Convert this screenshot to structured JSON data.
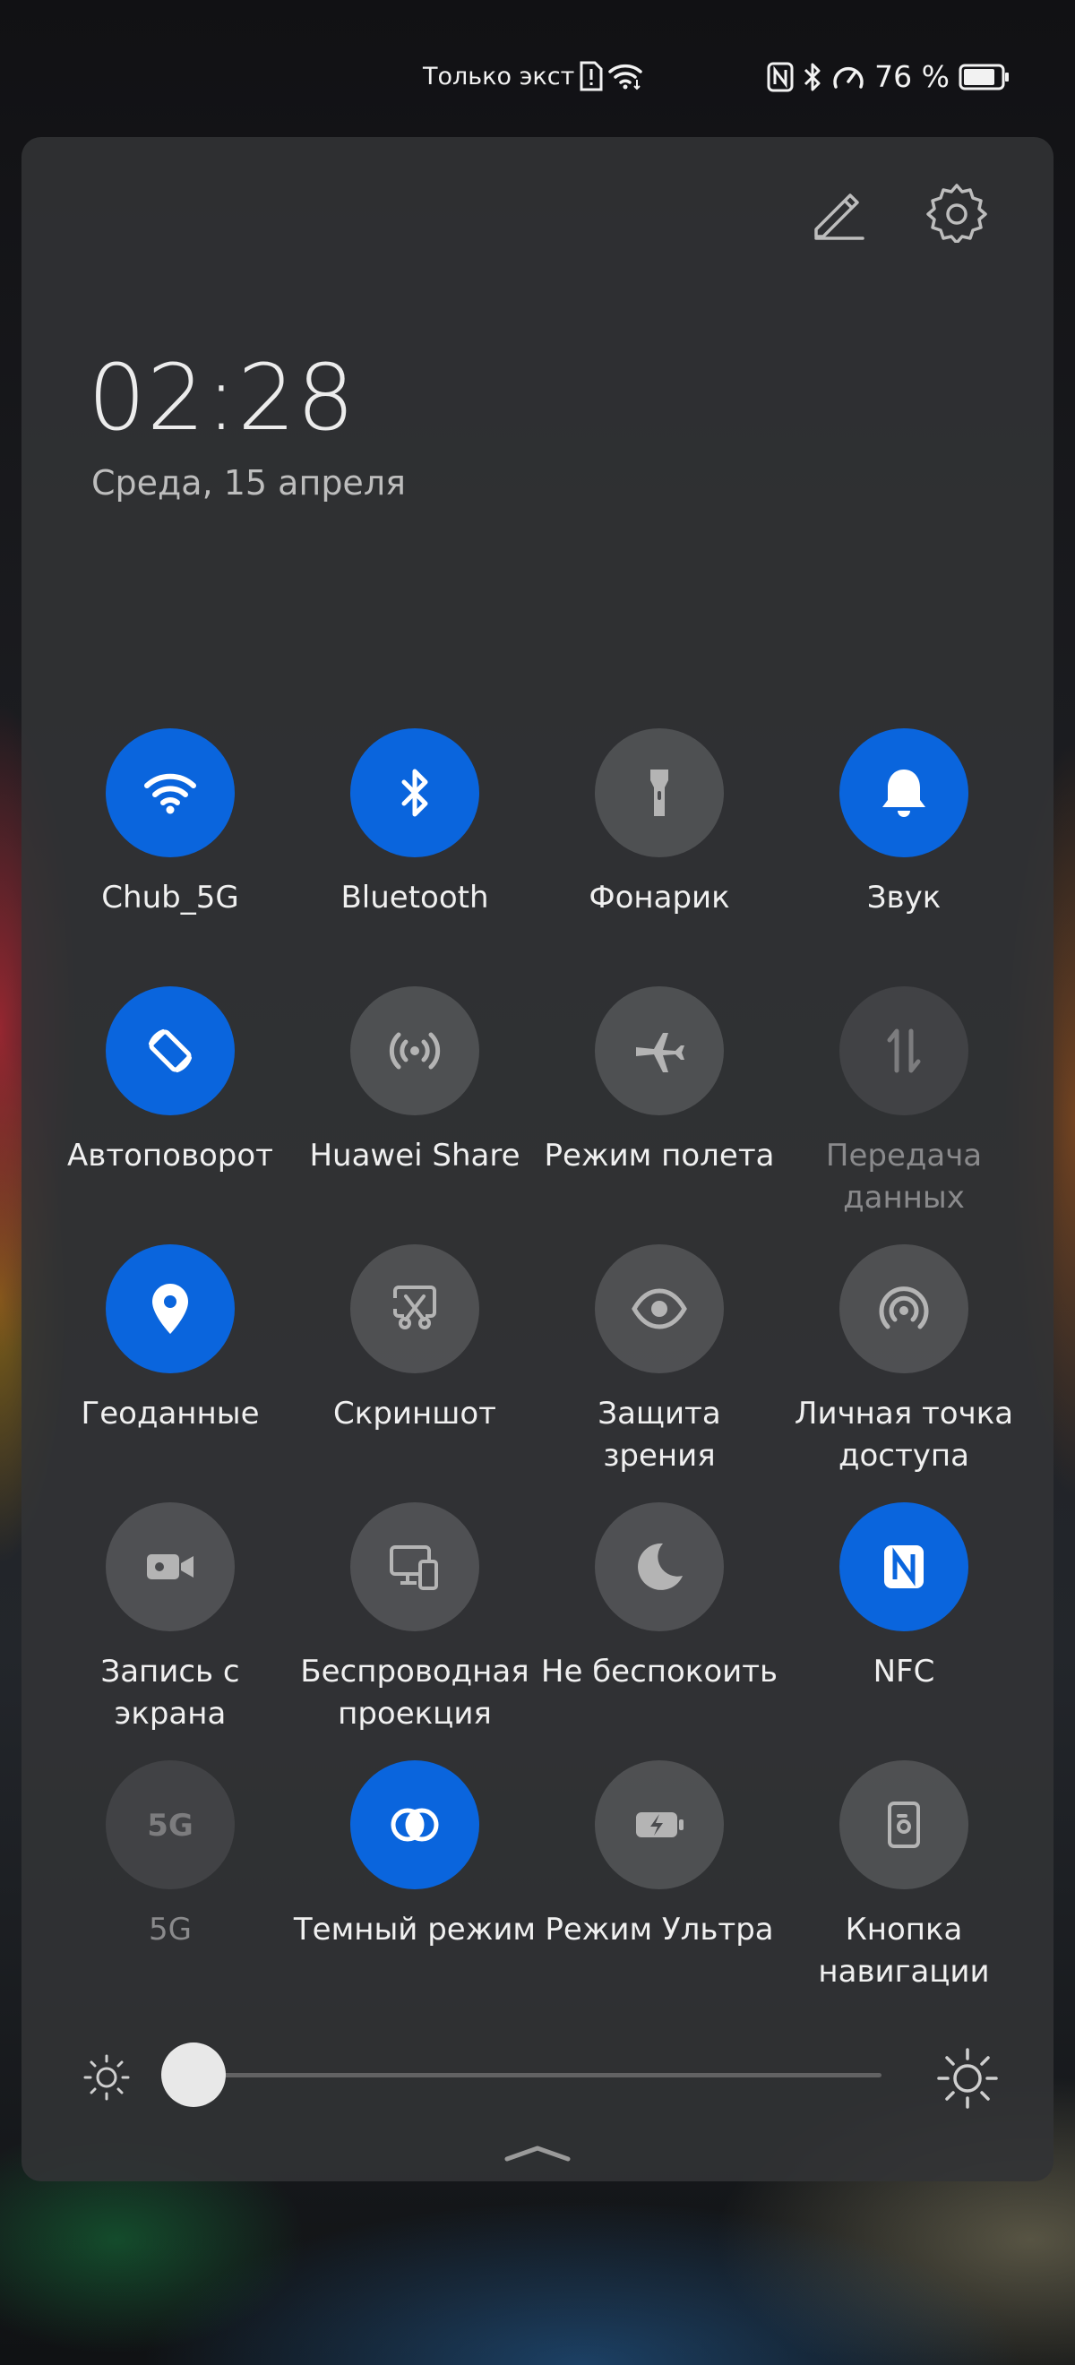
{
  "status": {
    "carrier_text": "Только экст",
    "battery_percent": "76 %",
    "battery_level": 0.76
  },
  "panel": {
    "time": "02:28",
    "date": "Среда, 15 апреля"
  },
  "tiles": [
    {
      "label": "Chub_5G",
      "state": "on",
      "icon": "wifi-icon"
    },
    {
      "label": "Bluetooth",
      "state": "on",
      "icon": "bluetooth-icon"
    },
    {
      "label": "Фонарик",
      "state": "off",
      "icon": "flashlight-icon"
    },
    {
      "label": "Звук",
      "state": "on",
      "icon": "bell-icon"
    },
    {
      "label": "Автоповорот",
      "state": "on",
      "icon": "autorotate-icon"
    },
    {
      "label": "Huawei Share",
      "state": "off",
      "icon": "share-icon"
    },
    {
      "label": "Режим полета",
      "state": "off",
      "icon": "airplane-icon"
    },
    {
      "label": "Передача данных",
      "state": "disabled",
      "icon": "data-transfer-icon"
    },
    {
      "label": "Геоданные",
      "state": "on",
      "icon": "location-icon"
    },
    {
      "label": "Скриншот",
      "state": "off",
      "icon": "screenshot-icon"
    },
    {
      "label": "Защита зрения",
      "state": "off",
      "icon": "eye-icon"
    },
    {
      "label": "Личная точка доступа",
      "state": "off",
      "icon": "hotspot-icon"
    },
    {
      "label": "Запись с экрана",
      "state": "off",
      "icon": "screen-record-icon"
    },
    {
      "label": "Беспроводная проекция",
      "state": "off",
      "icon": "wireless-projection-icon"
    },
    {
      "label": "Не беспокоить",
      "state": "off",
      "icon": "moon-icon"
    },
    {
      "label": "NFC",
      "state": "on",
      "icon": "nfc-icon"
    },
    {
      "label": "5G",
      "state": "disabled",
      "icon": "5g-icon"
    },
    {
      "label": "Темный режим",
      "state": "on",
      "icon": "dark-mode-icon"
    },
    {
      "label": "Режим Ультра",
      "state": "off",
      "icon": "battery-saver-icon"
    },
    {
      "label": "Кнопка навигации",
      "state": "off",
      "icon": "navigation-button-icon"
    }
  ],
  "brightness": {
    "level": 0.0
  },
  "colors": {
    "accent": "#0a65dd",
    "tile_off": "#5a5b5e",
    "panel": "#323336"
  }
}
